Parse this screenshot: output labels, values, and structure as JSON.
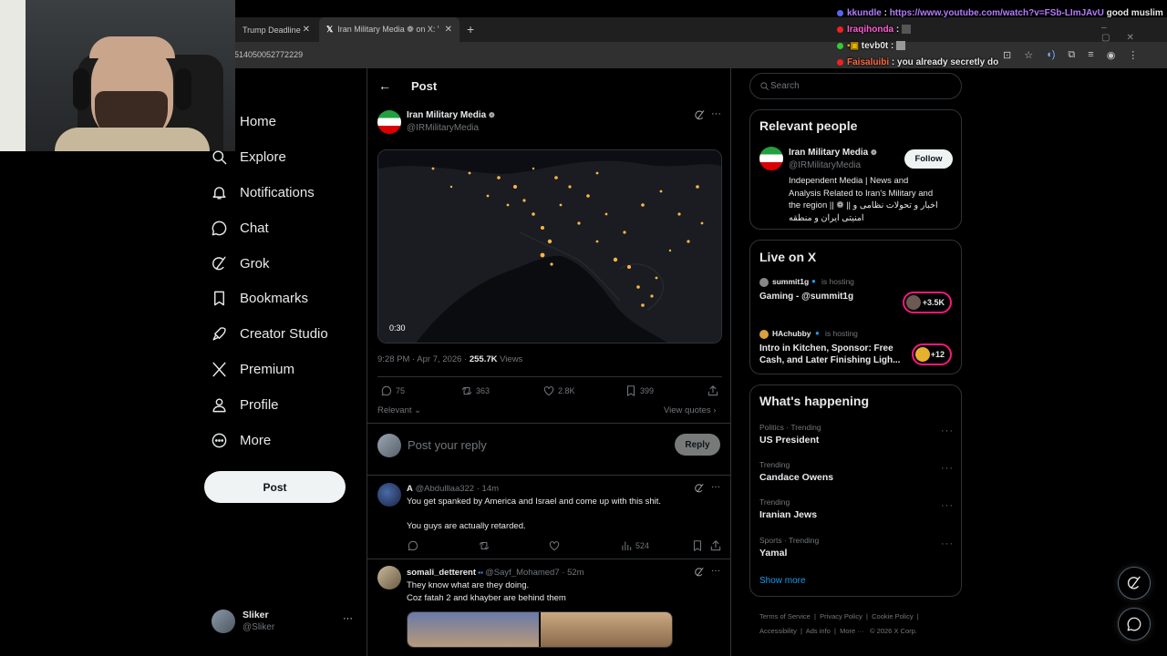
{
  "browser": {
    "tabs": [
      {
        "label": "Trump Deadline"
      },
      {
        "label": "Iran Military Media ❁ on X: \"htt"
      }
    ],
    "url": "514050052772229"
  },
  "chat": [
    {
      "user": "kkundle",
      "sep": " : ",
      "link": "https://www.youtube.com/watch?v=FSb-LImJAvU",
      "msg": " good muslim",
      "color": "#b47cff"
    },
    {
      "user": "Iraqihonda",
      "sep": " : ",
      "msg": "",
      "color": "#ff5fd2"
    },
    {
      "user": "tevb0t",
      "sep": " : ",
      "msg": "",
      "color": "#e7e9ea"
    },
    {
      "user": "Faisaluibi",
      "sep": " : ",
      "msg": "you already secretly do",
      "color": "#ff6a3d"
    }
  ],
  "nav": {
    "items": [
      {
        "label": "Home",
        "icon": "home-icon"
      },
      {
        "label": "Explore",
        "icon": "search-icon"
      },
      {
        "label": "Notifications",
        "icon": "bell-icon"
      },
      {
        "label": "Chat",
        "icon": "chat-bubble-icon"
      },
      {
        "label": "Grok",
        "icon": "grok-icon"
      },
      {
        "label": "Bookmarks",
        "icon": "bookmark-icon"
      },
      {
        "label": "Creator Studio",
        "icon": "rocket-icon"
      },
      {
        "label": "Premium",
        "icon": "x-logo-icon"
      },
      {
        "label": "Profile",
        "icon": "person-icon"
      },
      {
        "label": "More",
        "icon": "more-circle-icon"
      }
    ],
    "post_label": "Post",
    "account": {
      "name": "Sliker",
      "handle": "@Sliker",
      "menu": "···"
    }
  },
  "post": {
    "header": "Post",
    "author_name": "Iran Military Media",
    "author_handle": "@IRMilitaryMedia",
    "video_duration": "0:30",
    "timestamp": "9:28 PM · Apr 7, 2026 · ",
    "views_count": "255.7K",
    "views_label": " Views",
    "replies": "75",
    "reposts": "363",
    "likes": "2.8K",
    "bookmarks": "399",
    "sort_label": "Relevant",
    "view_quotes": "View quotes",
    "reply_placeholder": "Post your reply",
    "reply_button": "Reply"
  },
  "replies": [
    {
      "name": "A",
      "handle": "@Abdulllaa322 · 14m",
      "line1": "You get spanked by America and Israel and come up with this shit.",
      "line2": "You guys are actually retarded.",
      "views": "524"
    },
    {
      "name": "somali_detterent",
      "handle": "@Sayf_Mohamed7 · 52m",
      "line1": "They know what are they doing.",
      "line2": "Coz fatah 2 and khayber are behind them"
    }
  ],
  "search": {
    "placeholder": "Search"
  },
  "relevant_people": {
    "title": "Relevant people",
    "name": "Iran Military Media",
    "handle": "@IRMilitaryMedia",
    "follow": "Follow",
    "bio1": "Independent Media | News and",
    "bio2": "Analysis Related to Iran's Military and",
    "bio3": "the region || ❁ || اخبار و تحولات نظامی و",
    "bio4": "امنیتی ایران و منطقه"
  },
  "live": {
    "title": "Live on X",
    "items": [
      {
        "host": "summit1g",
        "status": "is hosting",
        "title": "Gaming - @summit1g",
        "count": "+3.5K"
      },
      {
        "host": "HAchubby",
        "status": "is hosting",
        "title1": "Intro in Kitchen, Sponsor: Free",
        "title2": "Cash, and Later Finishing Ligh...",
        "count": "+12"
      }
    ]
  },
  "happening": {
    "title": "What's happening",
    "trends": [
      {
        "meta": "Politics · Trending",
        "title": "US President"
      },
      {
        "meta": "Trending",
        "title": "Candace Owens"
      },
      {
        "meta": "Trending",
        "title": "Iranian Jews"
      },
      {
        "meta": "Sports · Trending",
        "title": "Yamal"
      }
    ],
    "show_more": "Show more"
  },
  "footer": {
    "links": [
      "Terms of Service",
      "Privacy Policy",
      "Cookie Policy",
      "Accessibility",
      "Ads info",
      "More ···",
      "© 2026 X Corp."
    ]
  }
}
